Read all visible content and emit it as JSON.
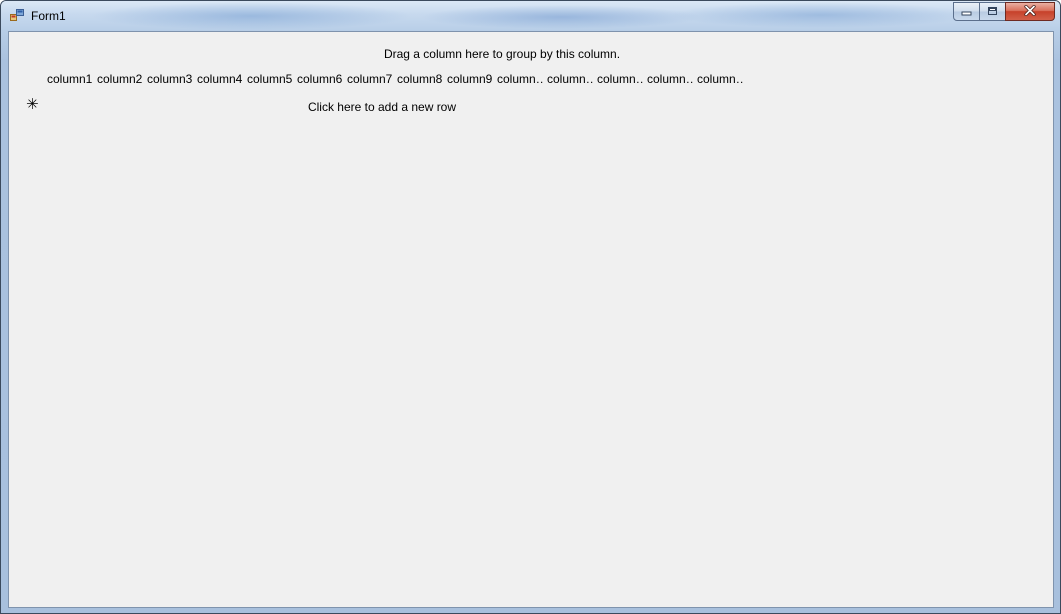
{
  "window": {
    "title": "Form1"
  },
  "caption_buttons": {
    "minimize_icon": "minimize-icon",
    "maximize_icon": "maximize-icon",
    "close_icon": "close-icon"
  },
  "grid": {
    "group_panel_text": "Drag a column here to group by this column.",
    "columns": [
      "column1",
      "column2",
      "column3",
      "column4",
      "column5",
      "column6",
      "column7",
      "column8",
      "column9",
      "column…",
      "column…",
      "column…",
      "column…",
      "column…"
    ],
    "new_row_indicator": "✳",
    "new_row_text": "Click here to add a new row"
  },
  "colors": {
    "title_bar": "#c7d9ee",
    "client_background": "#f0f0f0",
    "close_button": "#c6412a"
  }
}
